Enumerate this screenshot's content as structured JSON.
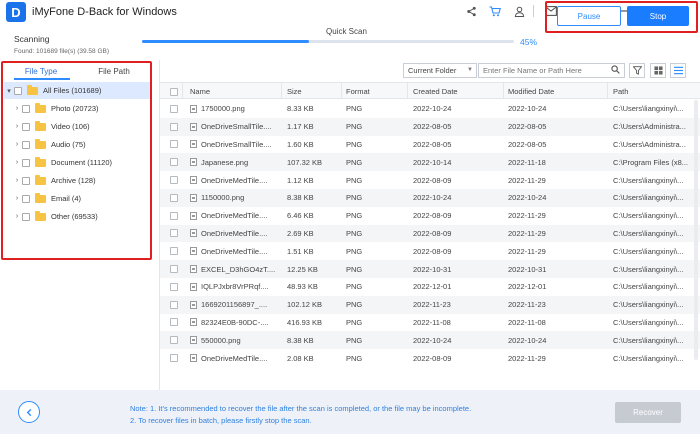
{
  "app": {
    "title": "iMyFone D-Back for Windows",
    "logo_letter": "D"
  },
  "titlebar_icons": [
    "share-icon",
    "cart-icon",
    "user-icon",
    "mail-icon",
    "feedback-icon",
    "menu-icon",
    "minimize-icon",
    "maximize-icon",
    "close-icon"
  ],
  "scan": {
    "status": "Scanning",
    "found": "Found: 101689 file(s) (39.58 GB)",
    "mode": "Quick Scan",
    "progress_percent": 45,
    "progress_label": "45%",
    "pause_label": "Pause",
    "stop_label": "Stop"
  },
  "left_panel": {
    "tabs": [
      "File Type",
      "File Path"
    ],
    "active_tab": "File Type",
    "tree": [
      {
        "label": "All Files (101689)",
        "level": 0,
        "selected": true
      },
      {
        "label": "Photo (20723)",
        "level": 1
      },
      {
        "label": "Video (106)",
        "level": 1
      },
      {
        "label": "Audio (75)",
        "level": 1
      },
      {
        "label": "Document (11120)",
        "level": 1
      },
      {
        "label": "Archive (128)",
        "level": 1
      },
      {
        "label": "Email (4)",
        "level": 1
      },
      {
        "label": "Other (69533)",
        "level": 1
      }
    ]
  },
  "filter": {
    "folder_select": "Current Folder",
    "search_placeholder": "Enter File Name or Path Here"
  },
  "table": {
    "columns": [
      "Name",
      "Size",
      "Format",
      "Created Date",
      "Modified Date",
      "Path"
    ],
    "rows": [
      [
        "1750000.png",
        "8.33 KB",
        "PNG",
        "2022-10-24",
        "2022-10-24",
        "C:\\Users\\liangxinyi\\..."
      ],
      [
        "OneDriveSmallTile....",
        "1.17 KB",
        "PNG",
        "2022-08-05",
        "2022-08-05",
        "C:\\Users\\Administra..."
      ],
      [
        "OneDriveSmallTile....",
        "1.60 KB",
        "PNG",
        "2022-08-05",
        "2022-08-05",
        "C:\\Users\\Administra..."
      ],
      [
        "Japanese.png",
        "107.32 KB",
        "PNG",
        "2022-10-14",
        "2022-11-18",
        "C:\\Program Files (x8..."
      ],
      [
        "OneDriveMedTile....",
        "1.12 KB",
        "PNG",
        "2022-08-09",
        "2022-11-29",
        "C:\\Users\\liangxinyi\\..."
      ],
      [
        "1150000.png",
        "8.38 KB",
        "PNG",
        "2022-10-24",
        "2022-10-24",
        "C:\\Users\\liangxinyi\\..."
      ],
      [
        "OneDriveMedTile....",
        "6.46 KB",
        "PNG",
        "2022-08-09",
        "2022-11-29",
        "C:\\Users\\liangxinyi\\..."
      ],
      [
        "OneDriveMedTile....",
        "2.69 KB",
        "PNG",
        "2022-08-09",
        "2022-11-29",
        "C:\\Users\\liangxinyi\\..."
      ],
      [
        "OneDriveMedTile....",
        "1.51 KB",
        "PNG",
        "2022-08-09",
        "2022-11-29",
        "C:\\Users\\liangxinyi\\..."
      ],
      [
        "EXCEL_D3hGO4zT....",
        "12.25 KB",
        "PNG",
        "2022-10-31",
        "2022-10-31",
        "C:\\Users\\liangxinyi\\..."
      ],
      [
        "IQLPJxbr8VrPRqf....",
        "48.93 KB",
        "PNG",
        "2022-12-01",
        "2022-12-01",
        "C:\\Users\\liangxinyi\\..."
      ],
      [
        "1669201156897_....",
        "102.12 KB",
        "PNG",
        "2022-11-23",
        "2022-11-23",
        "C:\\Users\\liangxinyi\\..."
      ],
      [
        "82324E0B-90DC-....",
        "416.93 KB",
        "PNG",
        "2022-11-08",
        "2022-11-08",
        "C:\\Users\\liangxinyi\\..."
      ],
      [
        "550000.png",
        "8.38 KB",
        "PNG",
        "2022-10-24",
        "2022-10-24",
        "C:\\Users\\liangxinyi\\..."
      ],
      [
        "OneDriveMedTile....",
        "2.08 KB",
        "PNG",
        "2022-08-09",
        "2022-11-29",
        "C:\\Users\\liangxinyi\\..."
      ]
    ]
  },
  "footer": {
    "note1": "Note: 1. It's recommended to recover the file after the scan is completed, or the file may be incomplete.",
    "note2": "2. To recover files in batch, please firstly stop the scan.",
    "recover_label": "Recover"
  },
  "colors": {
    "accent": "#2f8cff",
    "highlight_frame": "#e02020",
    "folder": "#f6c343"
  }
}
